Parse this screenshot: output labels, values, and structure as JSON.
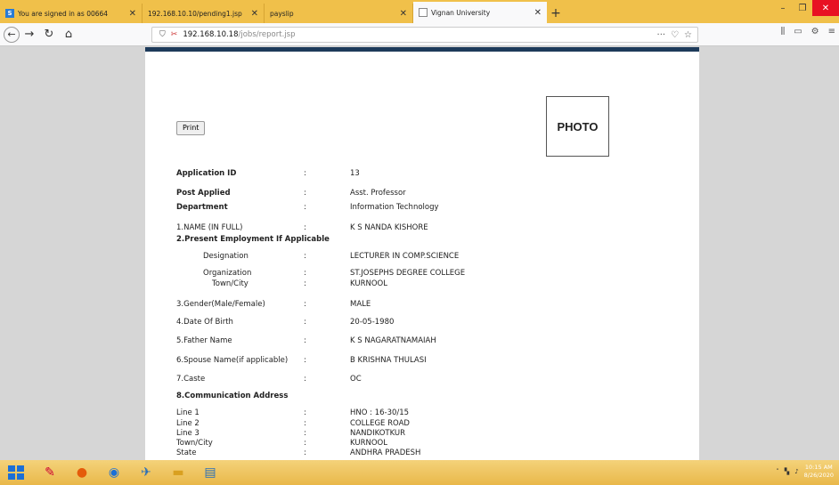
{
  "browser": {
    "tabs": [
      {
        "label": "You are signed in as 00664"
      },
      {
        "label": "192.168.10.10/pending1.jsp"
      },
      {
        "label": "payslip"
      },
      {
        "label": "Vignan University"
      }
    ],
    "new_tab_symbol": "+",
    "url_host": "192.168.10.18",
    "url_path": "/jobs/report.jsp",
    "url_more": "···"
  },
  "page": {
    "print_label": "Print",
    "photo_label": "PHOTO",
    "colon": ":",
    "rows": [
      {
        "label": "Application ID",
        "value": "13"
      },
      {
        "label": "Post Applied",
        "value": "Asst. Professor"
      },
      {
        "label": "Department",
        "value": "Information Technology"
      },
      {
        "label": "1.NAME (IN FULL)",
        "value": "K S NANDA KISHORE"
      },
      {
        "label": "2.Present Employment If Applicable",
        "value": ""
      },
      {
        "label": "Designation",
        "value": "LECTURER IN COMP.SCIENCE"
      },
      {
        "label": "Organization",
        "value": "ST.JOSEPHS DEGREE COLLEGE"
      },
      {
        "label": "Town/City",
        "value": "KURNOOL"
      },
      {
        "label": "3.Gender(Male/Female)",
        "value": "MALE"
      },
      {
        "label": "4.Date Of Birth",
        "value": "20-05-1980"
      },
      {
        "label": "5.Father Name",
        "value": "K S NAGARATNAMAIAH"
      },
      {
        "label": "6.Spouse Name(if applicable)",
        "value": "B KRISHNA THULASI"
      },
      {
        "label": "7.Caste",
        "value": "OC"
      },
      {
        "label": "8.Communication Address",
        "value": ""
      },
      {
        "label": "Line 1",
        "value": "HNO : 16-30/15"
      },
      {
        "label": "Line 2",
        "value": "COLLEGE ROAD"
      },
      {
        "label": "Line 3",
        "value": "NANDIKOTKUR"
      },
      {
        "label": "Town/City",
        "value": "KURNOOL"
      },
      {
        "label": "State",
        "value": "ANDHRA PRADESH"
      }
    ]
  },
  "taskbar": {
    "time": "10:15 AM",
    "date": "8/26/2020"
  }
}
